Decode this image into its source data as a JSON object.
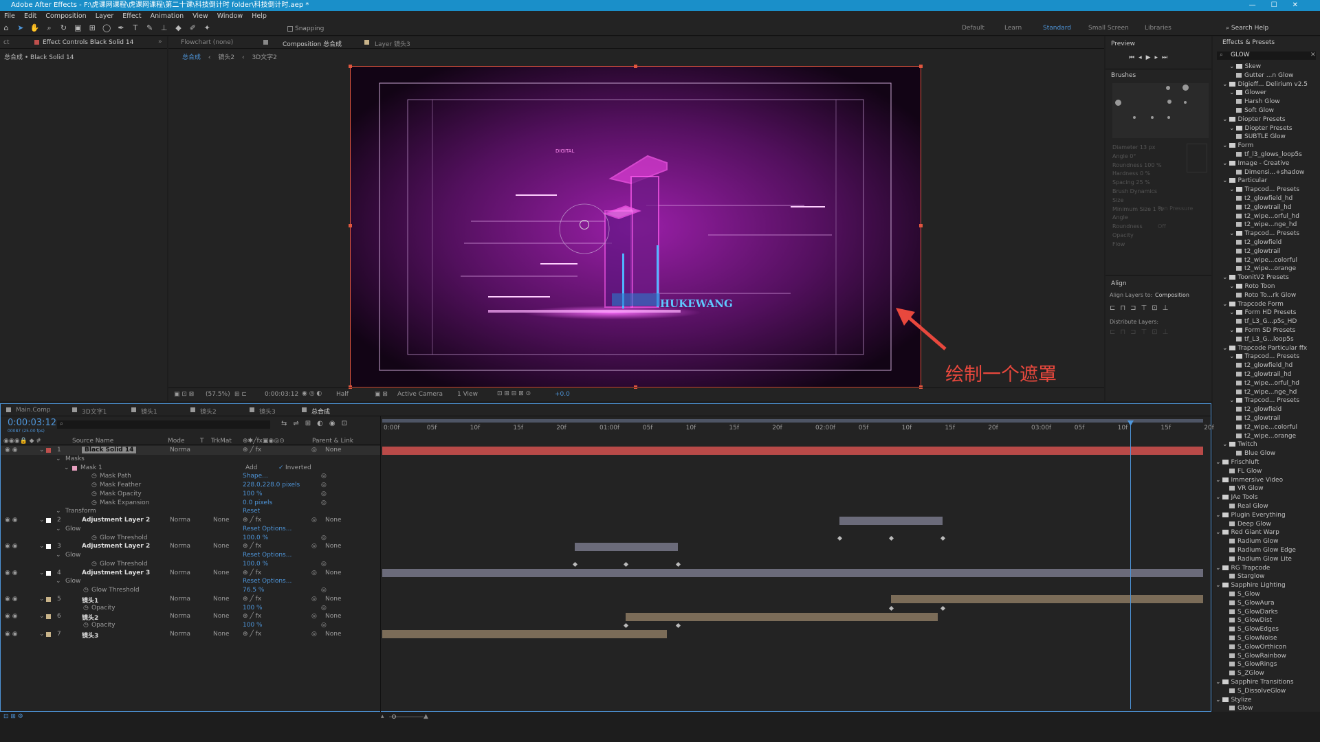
{
  "app": {
    "title": "Adobe After Effects - F:\\虎课网课程\\虎课网课程\\第二十课\\科技倒计时 folder\\科技倒计时.aep *"
  },
  "menu": [
    "File",
    "Edit",
    "Composition",
    "Layer",
    "Effect",
    "Animation",
    "View",
    "Window",
    "Help"
  ],
  "toolbar": {
    "snapping": "Snapping",
    "workspaces": [
      "Default",
      "Learn",
      "Standard",
      "Small Screen",
      "Libraries"
    ],
    "search_help": "Search Help"
  },
  "effect_controls": {
    "tab": "Effect Controls Black Solid 14",
    "tab_prefix": "ct",
    "breadcrumb": "总合成 • Black Solid 14"
  },
  "viewer": {
    "tabs": {
      "flowchart": "Flowchart (none)",
      "composition": "Composition 总合成",
      "layer": "Layer 镜头3"
    },
    "crumbs": [
      "总合成",
      "镜头2",
      "3D文字2"
    ],
    "footer": {
      "zoom": "(57.5%)",
      "time": "0:00:03:12",
      "resolution": "Half",
      "camera": "Active Camera",
      "views": "1 View",
      "exposure": "+0.0"
    },
    "art": {
      "digital": "DIGITAL",
      "brand": "HUKEWANG"
    },
    "annotation": "绘制一个遮罩"
  },
  "preview": {
    "title": "Preview"
  },
  "brushes": {
    "title": "Brushes",
    "props": [
      "Diameter 13 px",
      "Angle 0°",
      "Roundness 100 %",
      "Hardness 0 %",
      "Spacing 25 %",
      "Brush Dynamics",
      "Size",
      "Minimum Size 1 %",
      "Angle",
      "Roundness",
      "Opacity",
      "Flow"
    ],
    "dyn_value": "Pen Pressure",
    "off": "Off"
  },
  "align": {
    "title": "Align",
    "align_to_label": "Align Layers to:",
    "align_to_value": "Composition",
    "distribute": "Distribute Layers:"
  },
  "effects_presets": {
    "title": "Effects & Presets",
    "search": "GLOW",
    "items": [
      {
        "t": "Skew",
        "l": 2,
        "f": 1
      },
      {
        "t": "Gutter ...n Glow",
        "l": 3,
        "f": 0
      },
      {
        "t": "Digieff... Delirium v2.5",
        "l": 1,
        "f": 1
      },
      {
        "t": "Glower",
        "l": 2,
        "f": 1
      },
      {
        "t": "Harsh Glow",
        "l": 3,
        "f": 0
      },
      {
        "t": "Soft Glow",
        "l": 3,
        "f": 0
      },
      {
        "t": "Diopter Presets",
        "l": 1,
        "f": 1
      },
      {
        "t": "Diopter Presets",
        "l": 2,
        "f": 1
      },
      {
        "t": "SUBTLE Glow",
        "l": 3,
        "f": 0
      },
      {
        "t": "Form",
        "l": 1,
        "f": 1
      },
      {
        "t": "tf_l3_glows_loop5s",
        "l": 3,
        "f": 0
      },
      {
        "t": "Image - Creative",
        "l": 1,
        "f": 1
      },
      {
        "t": "Dimensi...+shadow",
        "l": 3,
        "f": 0
      },
      {
        "t": "Particular",
        "l": 1,
        "f": 1
      },
      {
        "t": "Trapcod... Presets",
        "l": 2,
        "f": 1
      },
      {
        "t": "t2_glowfield_hd",
        "l": 3,
        "f": 0
      },
      {
        "t": "t2_glowtrail_hd",
        "l": 3,
        "f": 0
      },
      {
        "t": "t2_wipe...orful_hd",
        "l": 3,
        "f": 0
      },
      {
        "t": "t2_wipe...nge_hd",
        "l": 3,
        "f": 0
      },
      {
        "t": "Trapcod... Presets",
        "l": 2,
        "f": 1
      },
      {
        "t": "t2_glowfield",
        "l": 3,
        "f": 0
      },
      {
        "t": "t2_glowtrail",
        "l": 3,
        "f": 0
      },
      {
        "t": "t2_wipe...colorful",
        "l": 3,
        "f": 0
      },
      {
        "t": "t2_wipe...orange",
        "l": 3,
        "f": 0
      },
      {
        "t": "ToonitV2 Presets",
        "l": 1,
        "f": 1
      },
      {
        "t": "Roto Toon",
        "l": 2,
        "f": 1
      },
      {
        "t": "Roto To...rk Glow",
        "l": 3,
        "f": 0
      },
      {
        "t": "Trapcode Form",
        "l": 1,
        "f": 1
      },
      {
        "t": "Form HD Presets",
        "l": 2,
        "f": 1
      },
      {
        "t": "tf_L3_G...p5s_HD",
        "l": 3,
        "f": 0
      },
      {
        "t": "Form SD Presets",
        "l": 2,
        "f": 1
      },
      {
        "t": "tf_L3_G...loop5s",
        "l": 3,
        "f": 0
      },
      {
        "t": "Trapcode Particular ffx",
        "l": 1,
        "f": 1
      },
      {
        "t": "Trapcod... Presets",
        "l": 2,
        "f": 1
      },
      {
        "t": "t2_glowfield_hd",
        "l": 3,
        "f": 0
      },
      {
        "t": "t2_glowtrail_hd",
        "l": 3,
        "f": 0
      },
      {
        "t": "t2_wipe...orful_hd",
        "l": 3,
        "f": 0
      },
      {
        "t": "t2_wipe...nge_hd",
        "l": 3,
        "f": 0
      },
      {
        "t": "Trapcod... Presets",
        "l": 2,
        "f": 1
      },
      {
        "t": "t2_glowfield",
        "l": 3,
        "f": 0
      },
      {
        "t": "t2_glowtrail",
        "l": 3,
        "f": 0
      },
      {
        "t": "t2_wipe...colorful",
        "l": 3,
        "f": 0
      },
      {
        "t": "t2_wipe...orange",
        "l": 3,
        "f": 0
      },
      {
        "t": "Twitch",
        "l": 1,
        "f": 1
      },
      {
        "t": "Blue Glow",
        "l": 3,
        "f": 0
      },
      {
        "t": "Frischluft",
        "l": 0,
        "f": 1
      },
      {
        "t": "FL Glow",
        "l": 2,
        "f": 0
      },
      {
        "t": "Immersive Video",
        "l": 0,
        "f": 1
      },
      {
        "t": "VR Glow",
        "l": 2,
        "f": 0
      },
      {
        "t": "JAe Tools",
        "l": 0,
        "f": 1
      },
      {
        "t": "Real Glow",
        "l": 2,
        "f": 0
      },
      {
        "t": "Plugin Everything",
        "l": 0,
        "f": 1
      },
      {
        "t": "Deep Glow",
        "l": 2,
        "f": 0
      },
      {
        "t": "Red Giant Warp",
        "l": 0,
        "f": 1
      },
      {
        "t": "Radium Glow",
        "l": 2,
        "f": 0
      },
      {
        "t": "Radium Glow Edge",
        "l": 2,
        "f": 0
      },
      {
        "t": "Radium Glow Lite",
        "l": 2,
        "f": 0
      },
      {
        "t": "RG Trapcode",
        "l": 0,
        "f": 1
      },
      {
        "t": "Starglow",
        "l": 2,
        "f": 0
      },
      {
        "t": "Sapphire Lighting",
        "l": 0,
        "f": 1
      },
      {
        "t": "S_Glow",
        "l": 2,
        "f": 0
      },
      {
        "t": "S_GlowAura",
        "l": 2,
        "f": 0
      },
      {
        "t": "S_GlowDarks",
        "l": 2,
        "f": 0
      },
      {
        "t": "S_GlowDist",
        "l": 2,
        "f": 0
      },
      {
        "t": "S_GlowEdges",
        "l": 2,
        "f": 0
      },
      {
        "t": "S_GlowNoise",
        "l": 2,
        "f": 0
      },
      {
        "t": "S_GlowOrthicon",
        "l": 2,
        "f": 0
      },
      {
        "t": "S_GlowRainbow",
        "l": 2,
        "f": 0
      },
      {
        "t": "S_GlowRings",
        "l": 2,
        "f": 0
      },
      {
        "t": "S_ZGlow",
        "l": 2,
        "f": 0
      },
      {
        "t": "Sapphire Transitions",
        "l": 0,
        "f": 1
      },
      {
        "t": "S_DissolveGlow",
        "l": 2,
        "f": 0
      },
      {
        "t": "Stylize",
        "l": 0,
        "f": 1
      },
      {
        "t": "Glow",
        "l": 2,
        "f": 0
      }
    ]
  },
  "timeline": {
    "tabs": [
      "Main.Comp",
      "3D文字1",
      "镜头1",
      "镜头2",
      "镜头3",
      "总合成"
    ],
    "timecode": "0:00:03:12",
    "timecode_sub": "00087 (25.00 fps)",
    "headers": {
      "source": "Source Name",
      "mode": "Mode",
      "t": "T",
      "trkmat": "TrkMat",
      "parent": "Parent & Link"
    },
    "ruler": [
      "0:00f",
      "05f",
      "10f",
      "15f",
      "20f",
      "01:00f",
      "05f",
      "10f",
      "15f",
      "20f",
      "02:00f",
      "05f",
      "10f",
      "15f",
      "20f",
      "03:00f",
      "05f",
      "10f",
      "15f",
      "20f"
    ],
    "rows": [
      {
        "type": "layer",
        "num": "1",
        "name": "Black Solid 14",
        "mode": "Norma",
        "trk": "",
        "parent": "None",
        "color": "#c0504d",
        "sel": true
      },
      {
        "type": "group",
        "name": "Masks",
        "ind": 1
      },
      {
        "type": "mask",
        "name": "Mask 1",
        "mode": "Add",
        "inv": "Inverted",
        "ind": 2
      },
      {
        "type": "prop",
        "name": "Mask Path",
        "val": "Shape...",
        "ind": 3
      },
      {
        "type": "prop",
        "name": "Mask Feather",
        "val": "228.0,228.0 pixels",
        "ind": 3
      },
      {
        "type": "prop",
        "name": "Mask Opacity",
        "val": "100 %",
        "ind": 3
      },
      {
        "type": "prop",
        "name": "Mask Expansion",
        "val": "0.0 pixels",
        "ind": 3
      },
      {
        "type": "group",
        "name": "Transform",
        "val": "Reset",
        "ind": 1
      },
      {
        "type": "layer",
        "num": "2",
        "name": "Adjustment Layer 2",
        "mode": "Norma",
        "trk": "None",
        "parent": "None",
        "color": "#ffffff"
      },
      {
        "type": "group",
        "name": "Glow",
        "val": "Reset    Options...",
        "ind": 1
      },
      {
        "type": "prop",
        "name": "Glow Threshold",
        "val": "100.0 %",
        "ind": 3
      },
      {
        "type": "layer",
        "num": "3",
        "name": "Adjustment Layer 2",
        "mode": "Norma",
        "trk": "None",
        "parent": "None",
        "color": "#ffffff"
      },
      {
        "type": "group",
        "name": "Glow",
        "val": "Reset    Options...",
        "ind": 1
      },
      {
        "type": "prop",
        "name": "Glow Threshold",
        "val": "100.0 %",
        "ind": 3
      },
      {
        "type": "layer",
        "num": "4",
        "name": "Adjustment Layer 3",
        "mode": "Norma",
        "trk": "None",
        "parent": "None",
        "color": "#ffffff"
      },
      {
        "type": "group",
        "name": "Glow",
        "val": "Reset    Options...",
        "ind": 1
      },
      {
        "type": "prop",
        "name": "Glow Threshold",
        "val": "76.5 %",
        "ind": 2
      },
      {
        "type": "layer",
        "num": "5",
        "name": "镜头1",
        "mode": "Norma",
        "trk": "None",
        "parent": "None",
        "color": "#c9b48a"
      },
      {
        "type": "prop",
        "name": "Opacity",
        "val": "100 %",
        "ind": 2
      },
      {
        "type": "layer",
        "num": "6",
        "name": "镜头2",
        "mode": "Norma",
        "trk": "None",
        "parent": "None",
        "color": "#c9b48a"
      },
      {
        "type": "prop",
        "name": "Opacity",
        "val": "100 %",
        "ind": 2
      },
      {
        "type": "layer",
        "num": "7",
        "name": "镜头3",
        "mode": "Norma",
        "trk": "None",
        "parent": "None",
        "color": "#c9b48a"
      }
    ]
  },
  "colors": {
    "accent": "#1a8fc9",
    "solid": "#b94a48",
    "adj": "#6b6b7a",
    "footage": "#7b6c58",
    "playhead": "#4e95d9",
    "annotation": "#e8483d"
  }
}
